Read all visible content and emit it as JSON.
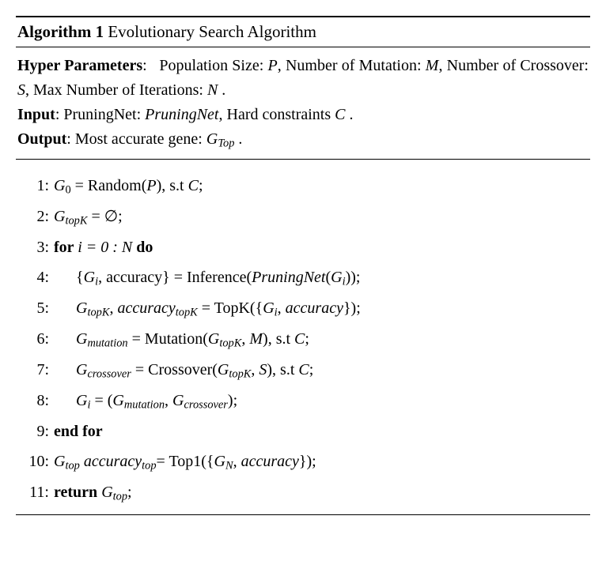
{
  "algo": {
    "number": "Algorithm 1",
    "title": "Evolutionary Search Algorithm",
    "hyper_label": "Hyper Parameters",
    "hyper_p1": "Population Size: ",
    "hyper_p2": ", Number of Mutation: ",
    "hyper_p3": ", Number of Crossover: ",
    "hyper_p4": ", Max Number of Iterations: ",
    "P": "P",
    "M": "M",
    "S": "S",
    "N": "N",
    "dot": " .",
    "input_label": "Input",
    "input_text1": "PruningNet: ",
    "pruningNet": "PruningNet",
    "input_text2": ", Hard constraints ",
    "C": "C",
    "output_label": "Output",
    "output_text": "Most accurate gene: ",
    "G": "G",
    "sub_Top": "Top",
    "steps": {
      "l1": {
        "n": "1:",
        "a": " = Random(",
        "b": "), s.t ",
        "c": ";",
        "sub0": "0"
      },
      "l2": {
        "n": "2:",
        "a": " = ∅;",
        "sub": "topK"
      },
      "l3": {
        "n": "3:",
        "for": "for ",
        "a": "i = 0 : ",
        "do": " do"
      },
      "l4": {
        "n": "4:",
        "a": "{",
        "b": ", accuracy} = Inference(",
        "c": "(",
        "d": "));",
        "sub_i": "i"
      },
      "l5": {
        "n": "5:",
        "a": ", ",
        "acc": "accuracy",
        "b": " = TopK({",
        "c": ", ",
        "d": "});",
        "sub_topK": "topK",
        "sub_i": "i"
      },
      "l6": {
        "n": "6:",
        "sub_mut": "mutation",
        "a": " = Mutation(",
        "b": ", ",
        "c": "), s.t ",
        "d": ";"
      },
      "l7": {
        "n": "7:",
        "sub_cr": "crossover",
        "a": " = Crossover(",
        "b": ", ",
        "c": "), s.t ",
        "d": ";"
      },
      "l8": {
        "n": "8:",
        "a": " = (",
        "b": ", ",
        "c": ");"
      },
      "l9": {
        "n": "9:",
        "endfor": "end for"
      },
      "l10": {
        "n": "10:",
        "sub_top": "top",
        "sp": " ",
        "a": "= Top1({",
        "b": ", ",
        "c": "});",
        "sub_N": "N"
      },
      "l11": {
        "n": "11:",
        "ret": "return ",
        "end": ";"
      }
    }
  }
}
